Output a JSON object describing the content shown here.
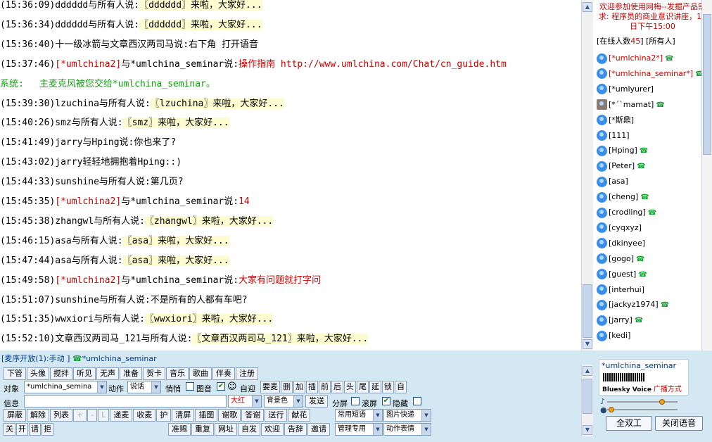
{
  "chat": {
    "messages": [
      {
        "time": "(15:36:09)",
        "who": "dddddd",
        "to": "与所有人说:",
        "body": "〖dddddd〗来啦，大家好...",
        "style": "hl"
      },
      {
        "time": "(15:36:34)",
        "who": "dddddd",
        "to": "与所有人说:",
        "body": "〖dddddd〗来啦，大家好...",
        "style": "hl"
      },
      {
        "time": "(15:36:40)",
        "who": "十一级冰箭",
        "to": "与文章西汉两司马说:",
        "body": "右下角 打开语音",
        "style": ""
      },
      {
        "time": "(15:37:46)",
        "who": "[*umlchina2]",
        "to": "与*umlchina_seminar说:",
        "body": "操作指南 http://www.umlchina.com/Chat/cn_guide.htm",
        "style": "red"
      },
      {
        "time": "系统:",
        "who": "",
        "to": "",
        "body": "主麦克风被您交给*umlchina_seminar。",
        "style": "grn"
      },
      {
        "time": "(15:39:30)",
        "who": "lzuchina",
        "to": "与所有人说:",
        "body": "〖lzuchina〗来啦，大家好...",
        "style": "hl"
      },
      {
        "time": "(15:40:26)",
        "who": "smz",
        "to": "与所有人说:",
        "body": "〖smz〗来啦，大家好...",
        "style": "hl"
      },
      {
        "time": "(15:41:49)",
        "who": "jarry",
        "to": "与Hping说:",
        "body": "你也来了?",
        "style": ""
      },
      {
        "time": "(15:43:02)",
        "who": "jarry",
        "to": "轻轻地拥抱着Hping::)",
        "body": "",
        "style": ""
      },
      {
        "time": "(15:44:33)",
        "who": "sunshine",
        "to": "与所有人说:",
        "body": "第几页?",
        "style": ""
      },
      {
        "time": "(15:45:35)",
        "who": "[*umlchina2]",
        "to": "与*umlchina_seminar说:",
        "body": "14",
        "style": "red"
      },
      {
        "time": "(15:45:38)",
        "who": "zhangwl",
        "to": "与所有人说:",
        "body": "〖zhangwl〗来啦，大家好...",
        "style": "hl"
      },
      {
        "time": "(15:46:15)",
        "who": "asa",
        "to": "与所有人说:",
        "body": "〖asa〗来啦，大家好...",
        "style": "hl"
      },
      {
        "time": "(15:47:44)",
        "who": "asa",
        "to": "与所有人说:",
        "body": "〖asa〗来啦，大家好...",
        "style": "hl"
      },
      {
        "time": "(15:49:58)",
        "who": "[*umlchina2]",
        "to": "与*umlchina_seminar说:",
        "body": "大家有问题就打字问",
        "style": "red"
      },
      {
        "time": "(15:51:07)",
        "who": "sunshine",
        "to": "与所有人说:",
        "body": "不是所有的人都有车吧?",
        "style": ""
      },
      {
        "time": "(15:51:35)",
        "who": "wwxiori",
        "to": "与所有人说:",
        "body": "〖wwxiori〗来啦，大家好...",
        "style": "hl"
      },
      {
        "time": "(15:52:10)",
        "who": "文章西汉两司马_121",
        "to": "与所有人说:",
        "body": "〖文章西汉两司马_121〗来啦，大家好...",
        "style": "hl"
      }
    ]
  },
  "right": {
    "notice": "欢迎参加使用网梅--发掘产品需求: 程序员的商业意识讲座，15日下午15:00",
    "online_prefix": "[在线人数",
    "online_count": "45",
    "online_suffix": "] [所有人]",
    "users": [
      {
        "name": "[*umlchina2*]",
        "phone": true,
        "red": true
      },
      {
        "name": "[*umlchina_seminar*]",
        "phone": true,
        "red": true
      },
      {
        "name": "[*umlyurer]",
        "phone": false
      },
      {
        "name": "[*´`mamat]",
        "phone": true,
        "photo": true
      },
      {
        "name": "[*斯鼎]",
        "phone": false
      },
      {
        "name": "[111]",
        "phone": false
      },
      {
        "name": "[Hping]",
        "phone": true
      },
      {
        "name": "[Peter]",
        "phone": true
      },
      {
        "name": "[asa]",
        "phone": false
      },
      {
        "name": "[cheng]",
        "phone": true
      },
      {
        "name": "[crodling]",
        "phone": true
      },
      {
        "name": "[cyqxyz]",
        "phone": false
      },
      {
        "name": "[dkinyee]",
        "phone": false
      },
      {
        "name": "[gogo]",
        "phone": true
      },
      {
        "name": "[guest]",
        "phone": true
      },
      {
        "name": "[interhui]",
        "phone": false
      },
      {
        "name": "[jackyz1974]",
        "phone": true
      },
      {
        "name": "[jarry]",
        "phone": true
      },
      {
        "name": "[kedi]",
        "phone": false
      }
    ]
  },
  "status": {
    "mic": "[麦序开放(1)",
    "mode": ":手动 ]",
    "speaker": "*umlchina_seminar"
  },
  "toolbar1": [
    "下管",
    "头像",
    "搅拌",
    "听见",
    "无声",
    "准备",
    "贺卡",
    "音乐",
    "歌曲",
    "伴奏",
    "注册"
  ],
  "row2": {
    "target_label": "对象",
    "target_value": "*umlchina_semina",
    "action_label": "动作",
    "action_value": "说话",
    "whisper": "悄悄",
    "pic": "图音",
    "pic2": "自迎",
    "small": [
      "要麦",
      "删",
      "加",
      "插",
      "前",
      "后",
      "头",
      "尾",
      "延",
      "锁",
      "自"
    ]
  },
  "row3": {
    "msg_label": "信息",
    "color_value": "大红",
    "bg_value": "背景色",
    "send": "发送",
    "split": "分屏",
    "scroll": "滚屏",
    "hide": "隐藏"
  },
  "row4": [
    "屏蔽",
    "解除",
    "列表",
    "+",
    "-",
    "L",
    "递麦",
    "收麦",
    "护",
    "清屏",
    "插图",
    "谢歌",
    "答谢",
    "送行",
    "献花"
  ],
  "row4_select": "常用短语",
  "row4_select2": "图片快递",
  "row5": [
    "关",
    "开",
    "请",
    "拒",
    "准赐",
    "重复",
    "网址",
    "自发",
    "欢迎",
    "告辞",
    "邀请"
  ],
  "row5_select": "管理专用",
  "row5_select2": "动作表情",
  "voice": {
    "name": "*umlchina_seminar",
    "brand": "Bluesky Voice",
    "mode": "广播方式",
    "btn_duplex": "全双工",
    "btn_close": "关闭语音"
  }
}
